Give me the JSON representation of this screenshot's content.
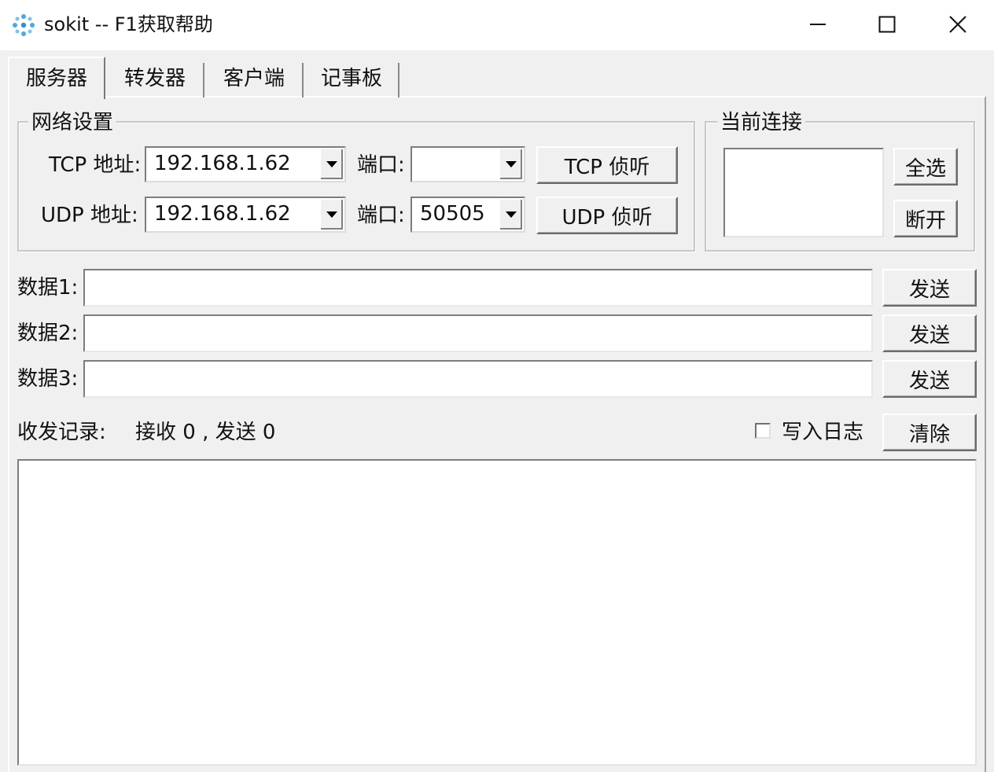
{
  "window": {
    "title": "sokit -- F1获取帮助",
    "icon": "sokit-dots-icon",
    "controls": {
      "minimize": "minimize-icon",
      "maximize": "maximize-icon",
      "close": "close-icon"
    }
  },
  "tabs": [
    {
      "label": "服务器",
      "active": true
    },
    {
      "label": "转发器",
      "active": false
    },
    {
      "label": "客户端",
      "active": false
    },
    {
      "label": "记事板",
      "active": false
    }
  ],
  "network": {
    "title": "网络设置",
    "tcp": {
      "label": "TCP 地址:",
      "address": "192.168.1.62",
      "port_label": "端口:",
      "port": "",
      "button": "TCP 侦听"
    },
    "udp": {
      "label": "UDP 地址:",
      "address": "192.168.1.62",
      "port_label": "端口:",
      "port": "50505",
      "button": "UDP 侦听"
    }
  },
  "connections": {
    "title": "当前连接",
    "select_all": "全选",
    "disconnect": "断开"
  },
  "data_rows": [
    {
      "label": "数据1:",
      "value": "",
      "send": "发送"
    },
    {
      "label": "数据2:",
      "value": "",
      "send": "发送"
    },
    {
      "label": "数据3:",
      "value": "",
      "send": "发送"
    }
  ],
  "log": {
    "label": "收发记录:",
    "stats": "接收 0 , 发送 0",
    "write_log_label": "写入日志",
    "write_log_checked": false,
    "clear": "清除"
  }
}
